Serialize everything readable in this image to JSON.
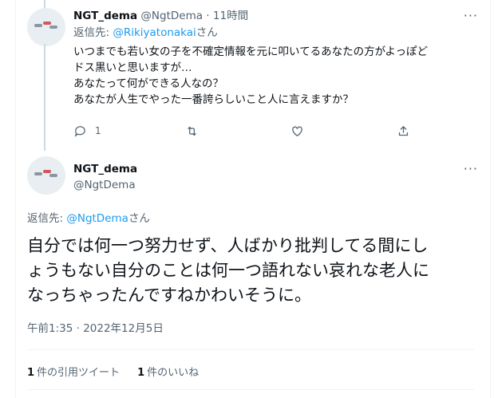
{
  "reply_tweet": {
    "name": "NGT_dema",
    "handle": "@NgtDema",
    "separator": "·",
    "time": "11時間",
    "reply_prefix": "返信先: ",
    "reply_to": "@Rikiyatonakai",
    "reply_suffix": "さん",
    "lines": [
      "いつまでも若い女の子を不確定情報を元に叩いてるあなたの方がよっぽど",
      "ドス黒いと思いますが…",
      "あなたって何ができる人なの？",
      "あなたが人生でやった一番誇らしいこと人に言えますか？"
    ],
    "more": "···",
    "reply_count": "1",
    "icons": [
      "reply-icon",
      "retweet-icon",
      "like-icon",
      "share-icon"
    ]
  },
  "main_tweet": {
    "name": "NGT_dema",
    "handle": "@NgtDema",
    "more": "···",
    "reply_prefix": "返信先: ",
    "reply_to": "@NgtDema",
    "reply_suffix": "さん",
    "lines": [
      "自分では何一つ努力せず、人ばかり批判してる間にし",
      "ょうもない自分のことは何一つ語れない哀れな老人に",
      "なっちゃったんですねかわいそうに。"
    ],
    "timestamp": "午前1:35 · 2022年12月5日",
    "quote_count": "1",
    "quote_label": "件の引用ツイート",
    "like_count": "1",
    "like_label": "件のいいね"
  },
  "colors": {
    "link": "#1d9bf0",
    "secondary_text": "#536471",
    "primary_text": "#0f1419",
    "divider": "#eff3f4"
  }
}
